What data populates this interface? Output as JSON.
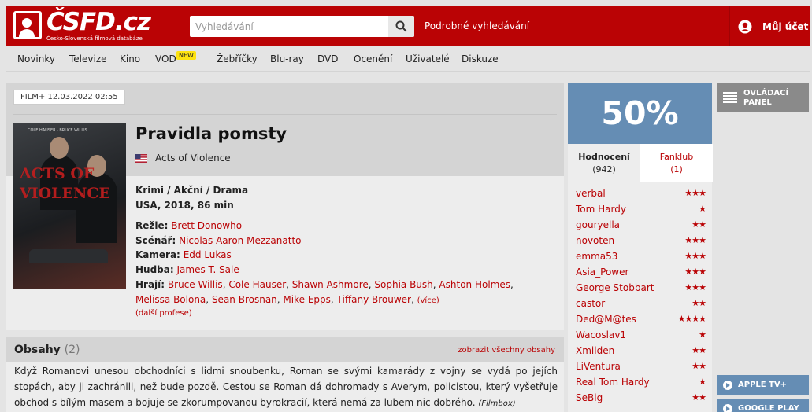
{
  "header": {
    "logo_text": "ČSFD.cz",
    "logo_subtitle": "Česko-Slovenská filmová databáze",
    "search_placeholder": "Vyhledávání",
    "advanced_search": "Podrobné vyhledávání",
    "account": "Můj účet",
    "accent_color": "#ba0305"
  },
  "nav": {
    "items": [
      "Novinky",
      "Televize",
      "Kino",
      "VOD",
      "Žebříčky",
      "Blu-ray",
      "DVD",
      "Ocenění",
      "Uživatelé",
      "Diskuze"
    ],
    "vod_badge": "NEW"
  },
  "film": {
    "tag": "FILM+ 12.03.2022 02:55",
    "title": "Pravidla pomsty",
    "original_title": "Acts of Violence",
    "genres": "Krimi / Akční / Drama",
    "origin": "USA, 2018, 86 min",
    "poster_title": "ACTS OF VIOLENCE",
    "poster_names": "COLE HAUSER · BRUCE WILLIS",
    "crew": {
      "director_label": "Režie:",
      "director": "Brett Donowho",
      "writer_label": "Scénář:",
      "writer": "Nicolas Aaron Mezzanatto",
      "camera_label": "Kamera:",
      "camera": "Edd Lukas",
      "music_label": "Hudba:",
      "music": "James T. Sale",
      "cast_label": "Hrají:",
      "cast": [
        "Bruce Willis",
        "Cole Hauser",
        "Shawn Ashmore",
        "Sophia Bush",
        "Ashton Holmes",
        "Melissa Bolona",
        "Sean Brosnan",
        "Mike Epps",
        "Tiffany Brouwer"
      ],
      "more": "(více)",
      "more_professions": "(další profese)"
    }
  },
  "plot": {
    "heading": "Obsahy",
    "count": "(2)",
    "show_all": "zobrazit všechny obsahy",
    "text": "Když Romanovi unesou obchodníci s lidmi snoubenku, Roman se svými kamarády z vojny se vydá po jejích stopách, aby ji zachránili, než bude pozdě. Cestou se Roman dá dohromady s Averym, policistou, který vyšetřuje obchod s bílým masem a bojuje se zkorumpovanou byrokracií, která nemá za lubem nic dobrého.",
    "source": "(Filmbox)"
  },
  "rating": {
    "score": "50%",
    "score_color": "#658db4",
    "tab_ratings": "Hodnocení",
    "tab_ratings_count": "(942)",
    "tab_fanclub": "Fanklub",
    "tab_fanclub_count": "(1)",
    "users": [
      {
        "name": "verbal",
        "stars": "★★★"
      },
      {
        "name": "Tom Hardy",
        "stars": "★"
      },
      {
        "name": "gouryella",
        "stars": "★★"
      },
      {
        "name": "novoten",
        "stars": "★★★"
      },
      {
        "name": "emma53",
        "stars": "★★★"
      },
      {
        "name": "Asia_Power",
        "stars": "★★★"
      },
      {
        "name": "George Stobbart",
        "stars": "★★★"
      },
      {
        "name": "castor",
        "stars": "★★"
      },
      {
        "name": "Ded@M@tes",
        "stars": "★★★★"
      },
      {
        "name": "Wacoslav1",
        "stars": "★"
      },
      {
        "name": "Xmilden",
        "stars": "★★"
      },
      {
        "name": "LiVentura",
        "stars": "★★"
      },
      {
        "name": "Real Tom Hardy",
        "stars": "★"
      },
      {
        "name": "SeBig",
        "stars": "★★"
      }
    ]
  },
  "side": {
    "panel_label_1": "OVLÁDACÍ",
    "panel_label_2": "PANEL",
    "apple_tv": "APPLE TV+",
    "google_play": "GOOGLE PLAY"
  }
}
